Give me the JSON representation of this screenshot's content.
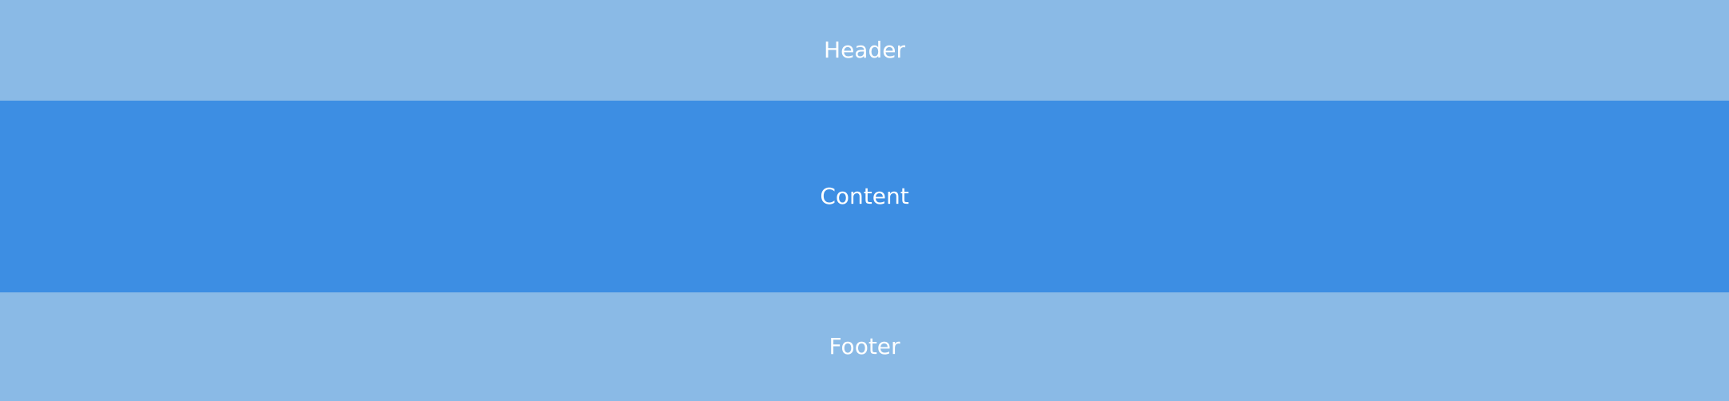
{
  "header": {
    "label": "Header",
    "background": "#8abae6"
  },
  "content": {
    "label": "Content",
    "background": "#3d8ee3"
  },
  "footer": {
    "label": "Footer",
    "background": "#8abae6"
  },
  "text_color": "#ffffff"
}
